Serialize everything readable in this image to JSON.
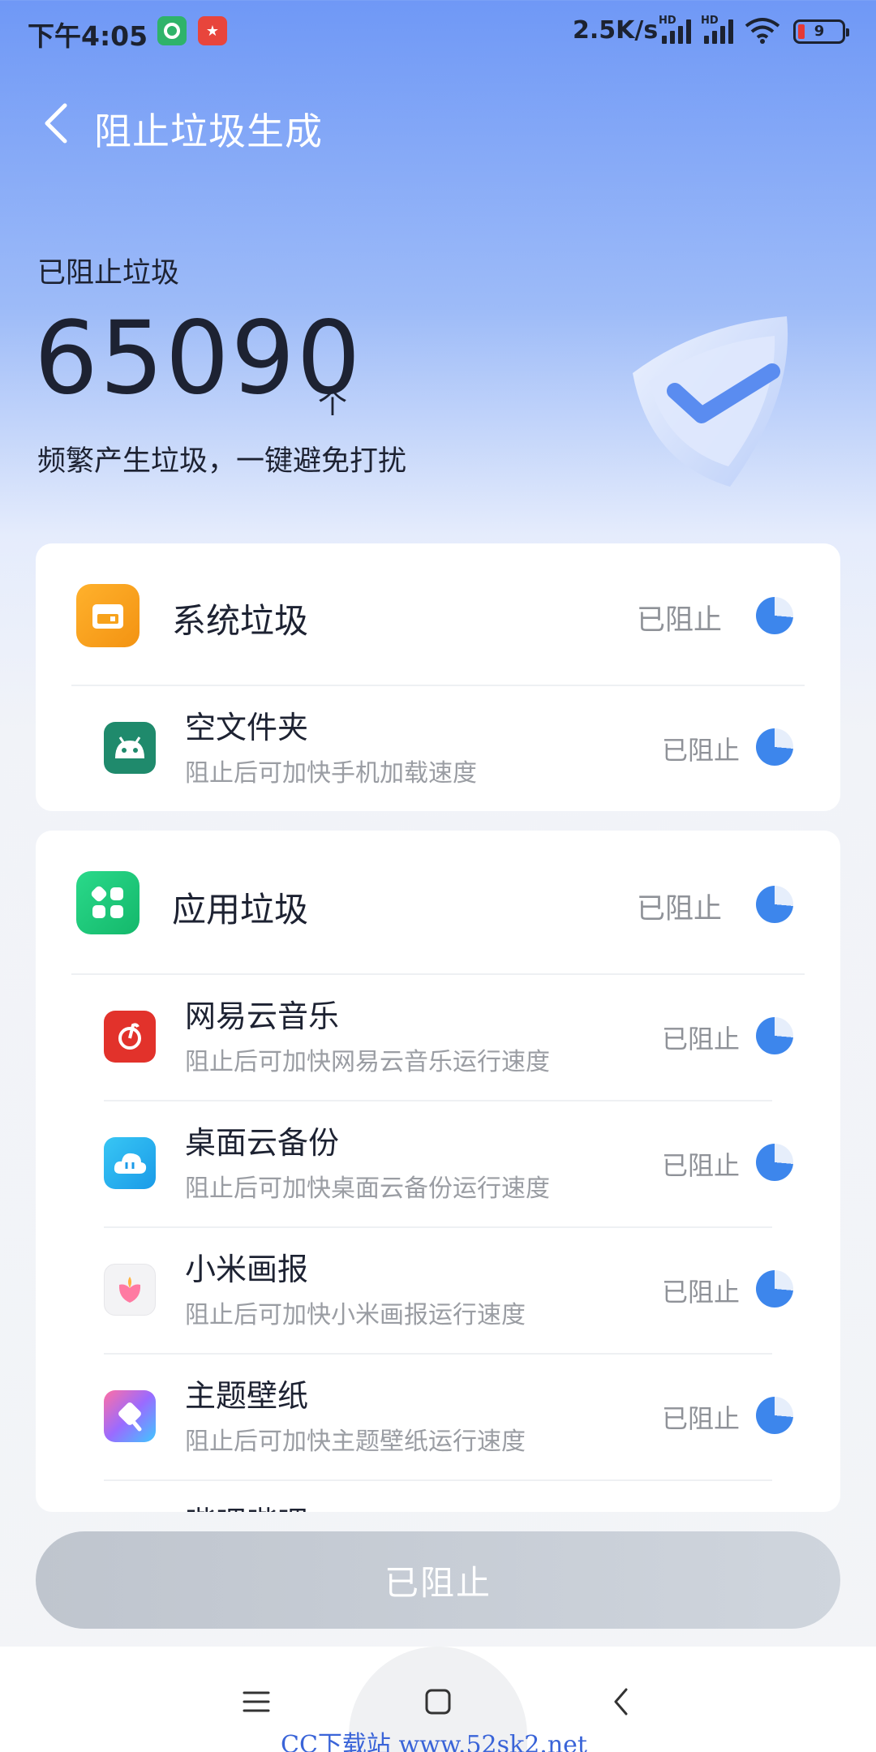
{
  "status_bar": {
    "time": "下午4:05",
    "net_speed": "2.5K/s",
    "sim1_label": "HD",
    "sim2_label": "HD",
    "battery": "9",
    "icons": [
      "app-green-icon",
      "app-red-icon",
      "signal-icon",
      "wifi-icon",
      "battery-icon"
    ]
  },
  "header": {
    "title": "阻止垃圾生成",
    "back_icon": "chevron-left-icon"
  },
  "hero": {
    "label": "已阻止垃圾",
    "count": "65090",
    "unit": "个",
    "description": "频繁产生垃圾，一键避免打扰",
    "illustration": "shield-check-icon"
  },
  "sections": [
    {
      "name": "系统垃圾",
      "status": "已阻止",
      "icon": "folder-icon",
      "color": "#f7a21b",
      "items": [
        {
          "name": "空文件夹",
          "desc": "阻止后可加快手机加载速度",
          "status": "已阻止",
          "icon": "android-icon"
        }
      ]
    },
    {
      "name": "应用垃圾",
      "status": "已阻止",
      "icon": "apps-grid-icon",
      "color": "#22c77e",
      "items": [
        {
          "name": "网易云音乐",
          "desc": "阻止后可加快网易云音乐运行速度",
          "status": "已阻止",
          "icon": "netease-music-icon"
        },
        {
          "name": "桌面云备份",
          "desc": "阻止后可加快桌面云备份运行速度",
          "status": "已阻止",
          "icon": "cloud-backup-icon"
        },
        {
          "name": "小米画报",
          "desc": "阻止后可加快小米画报运行速度",
          "status": "已阻止",
          "icon": "mi-wallpaper-icon"
        },
        {
          "name": "主题壁纸",
          "desc": "阻止后可加快主题壁纸运行速度",
          "status": "已阻止",
          "icon": "theme-icon"
        },
        {
          "name": "哔哩哔哩"
        }
      ]
    }
  ],
  "action_button": {
    "label": "已阻止"
  },
  "nav": {
    "menu_icon": "menu-icon",
    "home_icon": "home-square-icon",
    "back_icon": "back-triangle-icon"
  },
  "watermark": "CC下载站 www.52sk2.net",
  "colors": {
    "accent": "#3d86ec",
    "header_bg": "#6f98f6",
    "button_disabled": "#c4cad3"
  }
}
